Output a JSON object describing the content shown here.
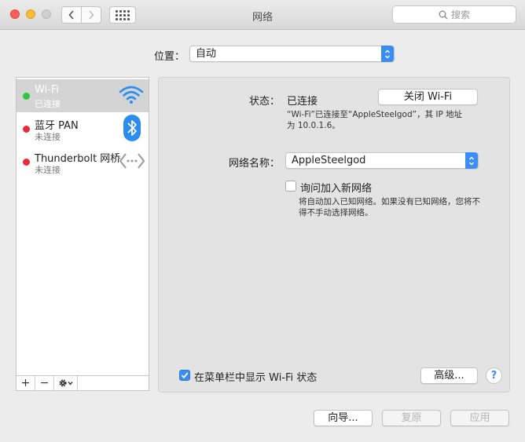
{
  "window": {
    "title": "网络",
    "search_placeholder": "搜索"
  },
  "location": {
    "label": "位置：",
    "value": "自动"
  },
  "services": [
    {
      "name": "Wi-Fi",
      "status": "已连接",
      "indicator": "green",
      "icon": "wifi-icon"
    },
    {
      "name": "蓝牙 PAN",
      "status": "未连接",
      "indicator": "red",
      "icon": "bluetooth-icon"
    },
    {
      "name": "Thunderbolt 网桥",
      "status": "未连接",
      "indicator": "red",
      "icon": "thunderbolt-bridge-icon"
    }
  ],
  "sidebar_tools": {
    "add": "+",
    "remove": "−"
  },
  "detail": {
    "status_label": "状态：",
    "status_value": "已连接",
    "toggle_wifi_button": "关闭 Wi-Fi",
    "status_desc_line1": "“Wi-Fi”已连接至“AppleSteelgod”，其 IP 地址",
    "status_desc_line2": "为 10.0.1.6。",
    "network_name_label": "网络名称：",
    "network_name_value": "AppleSteelgod",
    "ask_join_label": "询问加入新网络",
    "ask_join_checked": false,
    "ask_join_desc_line1": "将自动加入已知网络。如果没有已知网络，您将不",
    "ask_join_desc_line2": "得不手动选择网络。",
    "show_menubar_label": "在菜单栏中显示 Wi-Fi 状态",
    "show_menubar_checked": true,
    "advanced_button": "高级...",
    "help_button": "?"
  },
  "footer": {
    "assist_button": "向导...",
    "revert_button": "复原",
    "apply_button": "应用"
  },
  "colors": {
    "accent": "#3b8df5",
    "connected": "#2ec43f",
    "disconnected": "#ee2a3a",
    "selection": "#d4d4d4"
  }
}
